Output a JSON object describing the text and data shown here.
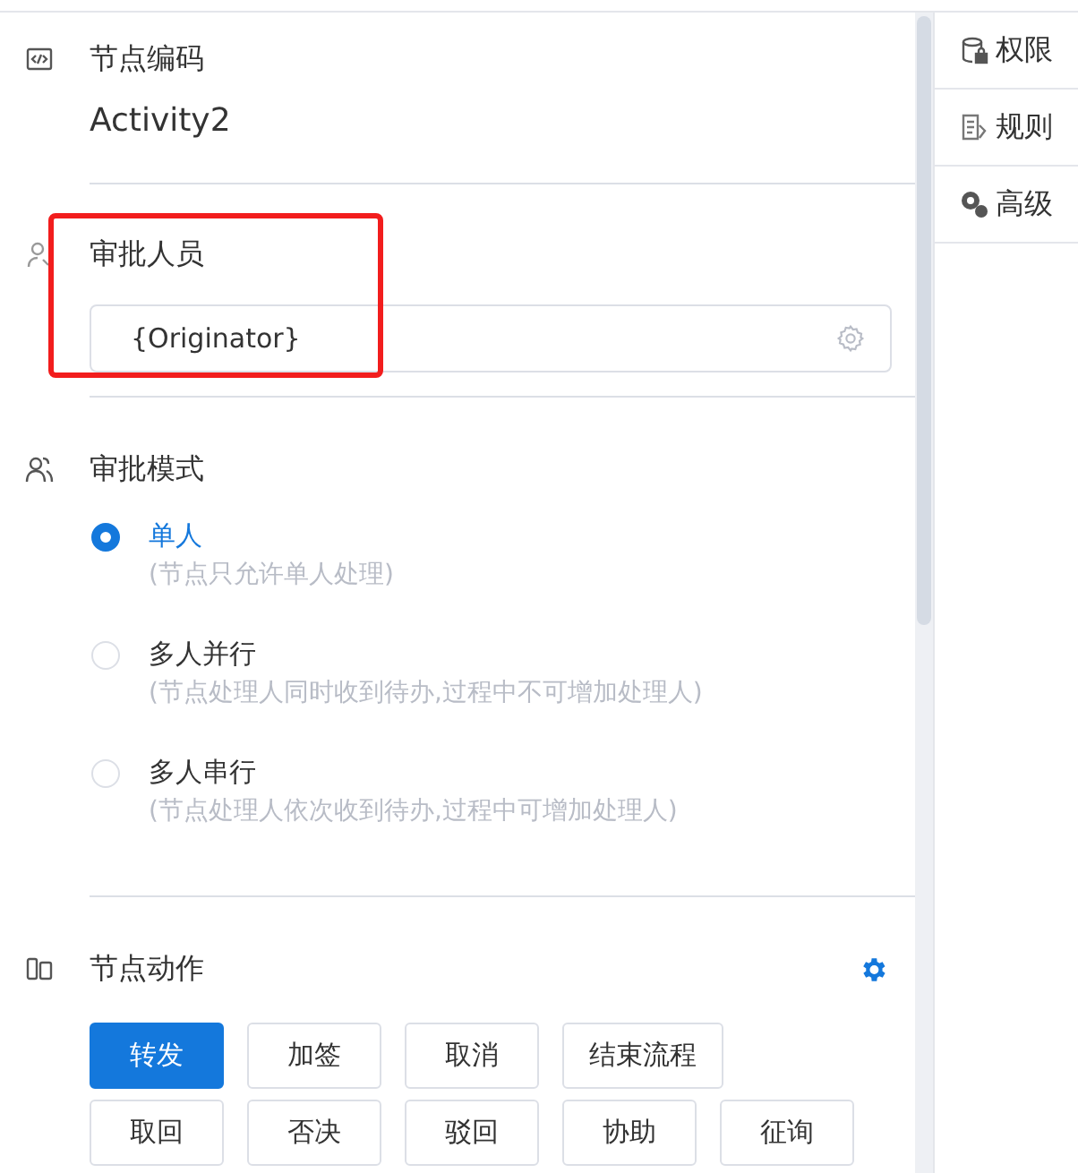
{
  "node_code": {
    "title": "节点编码",
    "value": "Activity2"
  },
  "approvers": {
    "title": "审批人员",
    "value": "{Originator}"
  },
  "approval_mode": {
    "title": "审批模式",
    "options": [
      {
        "label": "单人",
        "hint": "(节点只允许单人处理)",
        "selected": true
      },
      {
        "label": "多人并行",
        "hint": "(节点处理人同时收到待办,过程中不可增加处理人)",
        "selected": false
      },
      {
        "label": "多人串行",
        "hint": "(节点处理人依次收到待办,过程中可增加处理人)",
        "selected": false
      }
    ]
  },
  "node_actions": {
    "title": "节点动作",
    "buttons": [
      {
        "label": "转发",
        "selected": true
      },
      {
        "label": "加签",
        "selected": false
      },
      {
        "label": "取消",
        "selected": false
      },
      {
        "label": "结束流程",
        "selected": false
      },
      {
        "label": "取回",
        "selected": false
      },
      {
        "label": "否决",
        "selected": false
      },
      {
        "label": "驳回",
        "selected": false
      },
      {
        "label": "协助",
        "selected": false
      },
      {
        "label": "征询",
        "selected": false
      }
    ]
  },
  "sidebar": {
    "items": [
      {
        "kind": "lock",
        "label": "权限"
      },
      {
        "kind": "rules",
        "label": "规则"
      },
      {
        "kind": "gears",
        "label": "高级"
      }
    ]
  }
}
